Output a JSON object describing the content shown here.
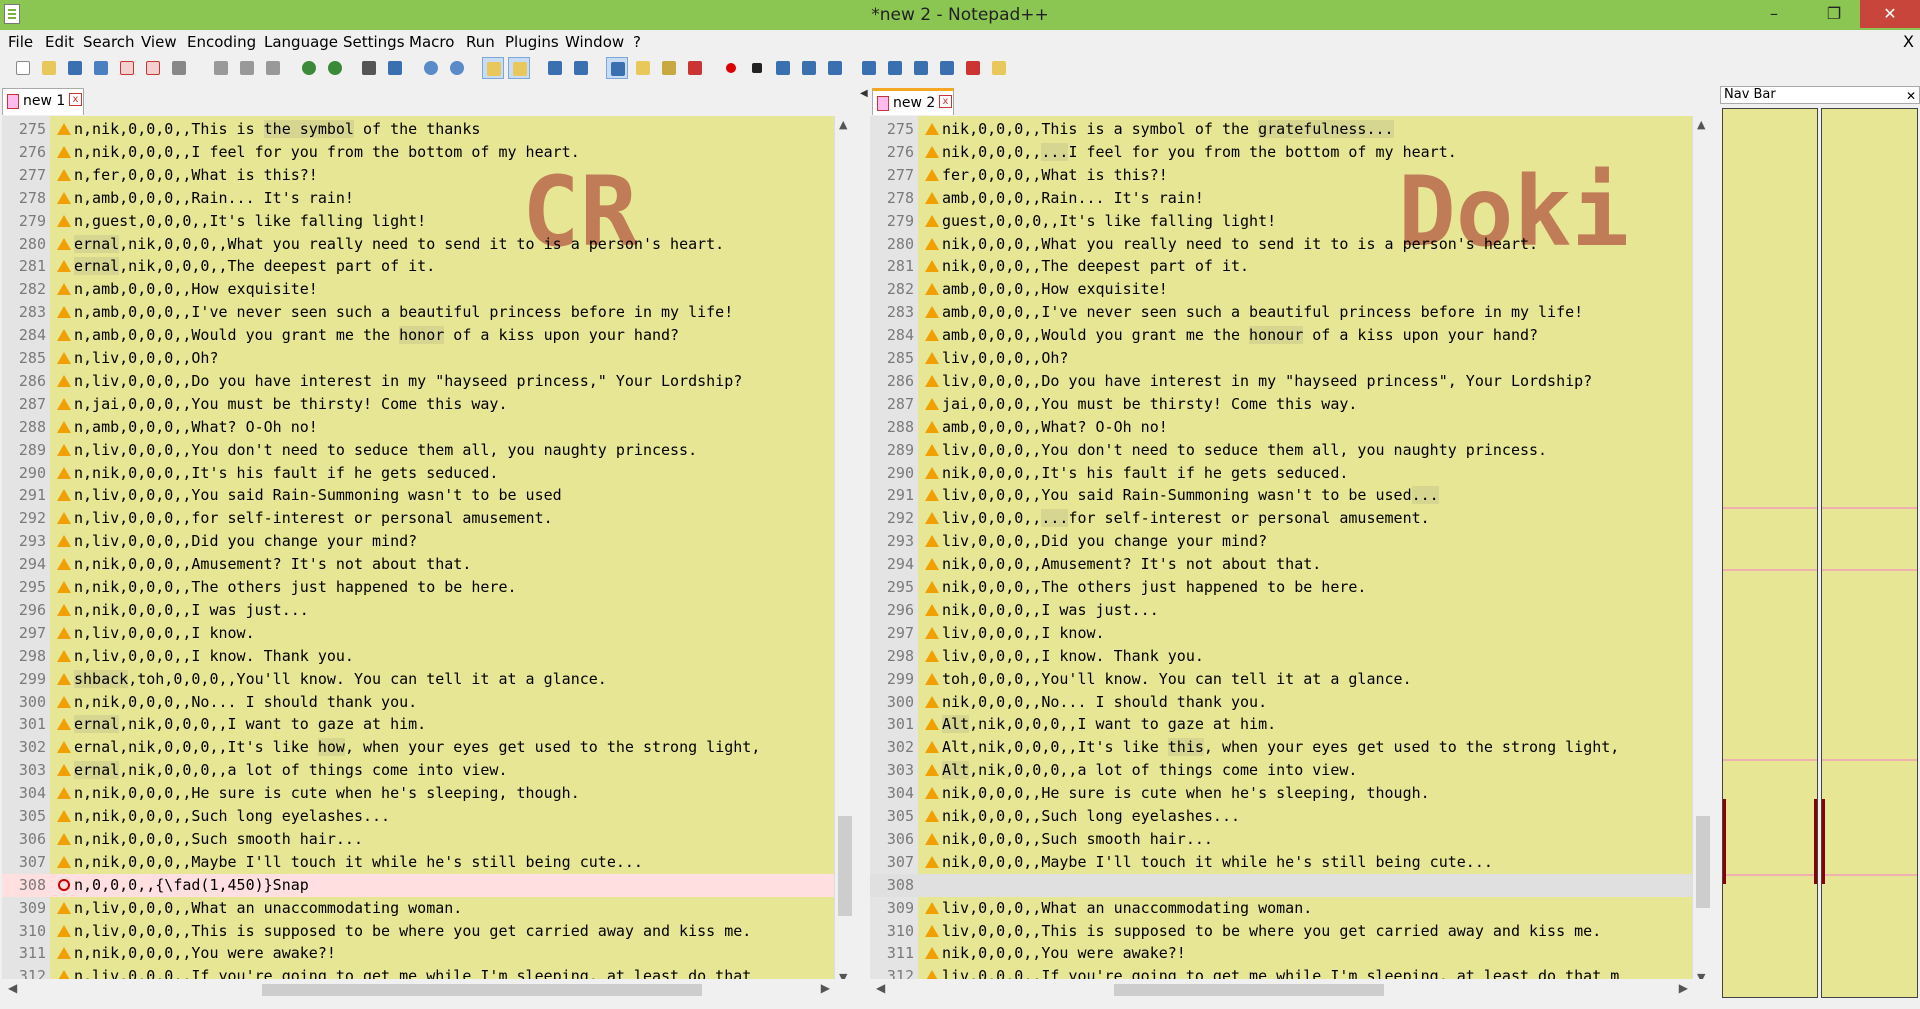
{
  "window": {
    "title": "*new 2 - Notepad++",
    "minimize": "–",
    "maximize": "❐",
    "close": "✕"
  },
  "menu": {
    "items": [
      "File",
      "Edit",
      "Search",
      "View",
      "Encoding",
      "Language",
      "Settings",
      "Macro",
      "Run",
      "Plugins",
      "Window",
      "?"
    ],
    "close": "X"
  },
  "left": {
    "tab": "new 1",
    "watermark": "CR",
    "lines": [
      {
        "n": "275",
        "t": "n,nik,0,0,0,,This is the symbol of the thanks",
        "mark": "warn"
      },
      {
        "n": "276",
        "t": "n,nik,0,0,0,,I feel for you from the bottom of my heart.",
        "mark": "warn"
      },
      {
        "n": "277",
        "t": "n,fer,0,0,0,,What is this?!",
        "mark": "warn"
      },
      {
        "n": "278",
        "t": "n,amb,0,0,0,,Rain... It's rain!",
        "mark": "warn"
      },
      {
        "n": "279",
        "t": "n,guest,0,0,0,,It's like falling light!",
        "mark": "warn"
      },
      {
        "n": "280",
        "t": "ernal,nik,0,0,0,,What you really need to send it to is a person's heart.",
        "mark": "warn"
      },
      {
        "n": "281",
        "t": "ernal,nik,0,0,0,,The deepest part of it.",
        "mark": "warn"
      },
      {
        "n": "282",
        "t": "n,amb,0,0,0,,How exquisite!",
        "mark": "warn"
      },
      {
        "n": "283",
        "t": "n,amb,0,0,0,,I've never seen such a beautiful princess before in my life!",
        "mark": "warn"
      },
      {
        "n": "284",
        "t": "n,amb,0,0,0,,Would you grant me the honor of a kiss upon your hand?",
        "mark": "warn"
      },
      {
        "n": "285",
        "t": "n,liv,0,0,0,,Oh?",
        "mark": "warn"
      },
      {
        "n": "286",
        "t": "n,liv,0,0,0,,Do you have interest in my \"hayseed princess,\" Your Lordship?",
        "mark": "warn"
      },
      {
        "n": "287",
        "t": "n,jai,0,0,0,,You must be thirsty! Come this way.",
        "mark": "warn"
      },
      {
        "n": "288",
        "t": "n,amb,0,0,0,,What? O-Oh no!",
        "mark": "warn"
      },
      {
        "n": "289",
        "t": "n,liv,0,0,0,,You don't need to seduce them all, you naughty princess.",
        "mark": "warn"
      },
      {
        "n": "290",
        "t": "n,nik,0,0,0,,It's his fault if he gets seduced.",
        "mark": "warn"
      },
      {
        "n": "291",
        "t": "n,liv,0,0,0,,You said Rain-Summoning wasn't to be used",
        "mark": "warn"
      },
      {
        "n": "292",
        "t": "n,liv,0,0,0,,for self-interest or personal amusement.",
        "mark": "warn"
      },
      {
        "n": "293",
        "t": "n,liv,0,0,0,,Did you change your mind?",
        "mark": "warn"
      },
      {
        "n": "294",
        "t": "n,nik,0,0,0,,Amusement? It's not about that.",
        "mark": "warn"
      },
      {
        "n": "295",
        "t": "n,nik,0,0,0,,The others just happened to be here.",
        "mark": "warn"
      },
      {
        "n": "296",
        "t": "n,nik,0,0,0,,I was just...",
        "mark": "warn"
      },
      {
        "n": "297",
        "t": "n,liv,0,0,0,,I know.",
        "mark": "warn"
      },
      {
        "n": "298",
        "t": "n,liv,0,0,0,,I know. Thank you.",
        "mark": "warn"
      },
      {
        "n": "299",
        "t": "shback,toh,0,0,0,,You'll know. You can tell it at a glance.",
        "mark": "warn"
      },
      {
        "n": "300",
        "t": "n,nik,0,0,0,,No... I should thank you.",
        "mark": "warn"
      },
      {
        "n": "301",
        "t": "ernal,nik,0,0,0,,I want to gaze at him.",
        "mark": "warn"
      },
      {
        "n": "302",
        "t": "ernal,nik,0,0,0,,It's like how, when your eyes get used to the strong light,",
        "mark": "warn"
      },
      {
        "n": "303",
        "t": "ernal,nik,0,0,0,,a lot of things come into view.",
        "mark": "warn"
      },
      {
        "n": "304",
        "t": "n,nik,0,0,0,,He sure is cute when he's sleeping, though.",
        "mark": "warn"
      },
      {
        "n": "305",
        "t": "n,nik,0,0,0,,Such long eyelashes...",
        "mark": "warn"
      },
      {
        "n": "306",
        "t": "n,nik,0,0,0,,Such smooth hair...",
        "mark": "warn"
      },
      {
        "n": "307",
        "t": "n,nik,0,0,0,,Maybe I'll touch it while he's still being cute...",
        "mark": "warn"
      },
      {
        "n": "308",
        "t": "n,0,0,0,,{\\fad(1,450)}Snap",
        "mark": "del",
        "style": "pink"
      },
      {
        "n": "309",
        "t": "n,liv,0,0,0,,What an unaccommodating woman.",
        "mark": "warn"
      },
      {
        "n": "310",
        "t": "n,liv,0,0,0,,This is supposed to be where you get carried away and kiss me.",
        "mark": "warn"
      },
      {
        "n": "311",
        "t": "n,nik,0,0,0,,You were awake?!",
        "mark": "warn"
      },
      {
        "n": "312",
        "t": "n,liv,0,0,0,,If you're going to get me while I'm sleeping, at least do that",
        "mark": "warn"
      }
    ]
  },
  "right": {
    "tab": "new 2",
    "watermark": "Doki",
    "lines": [
      {
        "n": "275",
        "t": "nik,0,0,0,,This is a symbol of the gratefulness...",
        "mark": "warn"
      },
      {
        "n": "276",
        "t": "nik,0,0,0,,...I feel for you from the bottom of my heart.",
        "mark": "warn"
      },
      {
        "n": "277",
        "t": "fer,0,0,0,,What is this?!",
        "mark": "warn"
      },
      {
        "n": "278",
        "t": "amb,0,0,0,,Rain... It's rain!",
        "mark": "warn"
      },
      {
        "n": "279",
        "t": "guest,0,0,0,,It's like falling light!",
        "mark": "warn"
      },
      {
        "n": "280",
        "t": "nik,0,0,0,,What you really need to send it to is a person's heart.",
        "mark": "warn"
      },
      {
        "n": "281",
        "t": "nik,0,0,0,,The deepest part of it.",
        "mark": "warn"
      },
      {
        "n": "282",
        "t": "amb,0,0,0,,How exquisite!",
        "mark": "warn"
      },
      {
        "n": "283",
        "t": "amb,0,0,0,,I've never seen such a beautiful princess before in my life!",
        "mark": "warn"
      },
      {
        "n": "284",
        "t": "amb,0,0,0,,Would you grant me the honour of a kiss upon your hand?",
        "mark": "warn"
      },
      {
        "n": "285",
        "t": "liv,0,0,0,,Oh?",
        "mark": "warn"
      },
      {
        "n": "286",
        "t": "liv,0,0,0,,Do you have interest in my \"hayseed princess\", Your Lordship?",
        "mark": "warn"
      },
      {
        "n": "287",
        "t": "jai,0,0,0,,You must be thirsty! Come this way.",
        "mark": "warn"
      },
      {
        "n": "288",
        "t": "amb,0,0,0,,What? O-Oh no!",
        "mark": "warn"
      },
      {
        "n": "289",
        "t": "liv,0,0,0,,You don't need to seduce them all, you naughty princess.",
        "mark": "warn"
      },
      {
        "n": "290",
        "t": "nik,0,0,0,,It's his fault if he gets seduced.",
        "mark": "warn"
      },
      {
        "n": "291",
        "t": "liv,0,0,0,,You said Rain-Summoning wasn't to be used...",
        "mark": "warn"
      },
      {
        "n": "292",
        "t": "liv,0,0,0,,...for self-interest or personal amusement.",
        "mark": "warn"
      },
      {
        "n": "293",
        "t": "liv,0,0,0,,Did you change your mind?",
        "mark": "warn"
      },
      {
        "n": "294",
        "t": "nik,0,0,0,,Amusement? It's not about that.",
        "mark": "warn"
      },
      {
        "n": "295",
        "t": "nik,0,0,0,,The others just happened to be here.",
        "mark": "warn"
      },
      {
        "n": "296",
        "t": "nik,0,0,0,,I was just...",
        "mark": "warn"
      },
      {
        "n": "297",
        "t": "liv,0,0,0,,I know.",
        "mark": "warn"
      },
      {
        "n": "298",
        "t": "liv,0,0,0,,I know. Thank you.",
        "mark": "warn"
      },
      {
        "n": "299",
        "t": "toh,0,0,0,,You'll know. You can tell it at a glance.",
        "mark": "warn"
      },
      {
        "n": "300",
        "t": "nik,0,0,0,,No... I should thank you.",
        "mark": "warn"
      },
      {
        "n": "301",
        "t": "Alt,nik,0,0,0,,I want to gaze at him.",
        "mark": "warn"
      },
      {
        "n": "302",
        "t": "Alt,nik,0,0,0,,It's like this, when your eyes get used to the strong light,",
        "mark": "warn"
      },
      {
        "n": "303",
        "t": "Alt,nik,0,0,0,,a lot of things come into view.",
        "mark": "warn"
      },
      {
        "n": "304",
        "t": "nik,0,0,0,,He sure is cute when he's sleeping, though.",
        "mark": "warn"
      },
      {
        "n": "305",
        "t": "nik,0,0,0,,Such long eyelashes...",
        "mark": "warn"
      },
      {
        "n": "306",
        "t": "nik,0,0,0,,Such smooth hair...",
        "mark": "warn"
      },
      {
        "n": "307",
        "t": "nik,0,0,0,,Maybe I'll touch it while he's still being cute...",
        "mark": "warn"
      },
      {
        "n": "308",
        "t": "",
        "mark": "none",
        "style": "gray"
      },
      {
        "n": "309",
        "t": "liv,0,0,0,,What an unaccommodating woman.",
        "mark": "warn"
      },
      {
        "n": "310",
        "t": "liv,0,0,0,,This is supposed to be where you get carried away and kiss me.",
        "mark": "warn"
      },
      {
        "n": "311",
        "t": "nik,0,0,0,,You were awake?!",
        "mark": "warn"
      },
      {
        "n": "312",
        "t": "liv,0,0,0,,If you're going to get me while I'm sleeping, at least do that m",
        "mark": "warn"
      }
    ]
  },
  "navbar": {
    "title": "Nav Bar",
    "close": "✕"
  },
  "colors": {
    "titlebar": "#8cc652",
    "editor_bg": "#e6e695",
    "diff_highlight": "#d6d690",
    "deleted_line": "#ffdfdf",
    "warn_marker": "#f0a000",
    "watermark": "#c07c56"
  }
}
